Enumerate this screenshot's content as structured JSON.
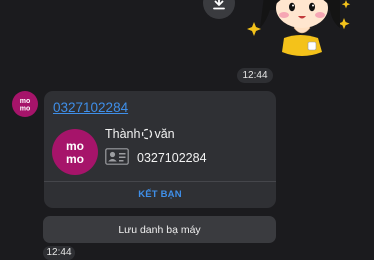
{
  "message": {
    "download_icon": "download-icon",
    "sticker": "girl-praying-sticker",
    "time_top": "12:44",
    "sender_avatar": {
      "logo_text": [
        "mo",
        "mo"
      ],
      "color": "#a6146a"
    },
    "card": {
      "phone_link": "0327102284",
      "contact_name_part1": "Thành",
      "contact_name_part2": "văn",
      "contact_avatar": {
        "logo_text": [
          "mo",
          "mo"
        ],
        "color": "#a6146a"
      },
      "contact_phone": "0327102284",
      "add_friend_label": "KẾT BẠN"
    },
    "save_contact_label": "Lưu danh bạ máy",
    "time_bottom": "12:44"
  },
  "colors": {
    "background": "#1b1b1e",
    "bubble": "#2f3034",
    "link": "#3f8fe9",
    "brand": "#a6146a"
  }
}
